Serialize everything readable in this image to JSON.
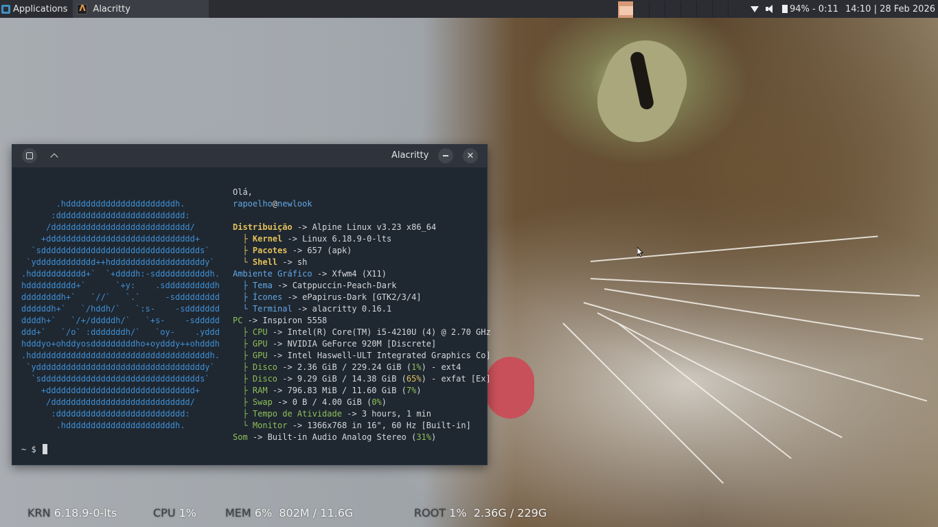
{
  "panel": {
    "applications_label": "Applications",
    "task_title": "Alacritty",
    "battery": "94% - 0:11",
    "clock": "14:10 | 28 Feb 2026"
  },
  "window": {
    "title": "Alacritty"
  },
  "terminal": {
    "logo_lines": [
      "       .hddddddddddddddddddddddh.",
      "      :dddddddddddddddddddddddddd:",
      "     /dddddddddddddddddddddddddddd/",
      "    +dddddddddddddddddddddddddddddd+",
      "  `sdddddddddddddddddddddddddddddddds`",
      " `ydddddddddddd++hdddddddddddddddddddy`",
      ".hddddddddddd+`  `+ddddh:-sdddddddddddh.",
      "hdddddddddd+`      `+y:    .sddddddddddh",
      "ddddddddh+`   `//`   `.`     -sddddddddd",
      "ddddddh+`   `/hddh/`   `:s-    -sddddddd",
      "ddddh+`   `/+/dddddh/`   `+s-    -sddddd",
      "ddd+`   `/o` :dddddddh/`   `oy-    .yddd",
      "hdddyo+ohddyosdddddddddho+oydddy++ohdddh",
      ".hddddddddddddddddddddddddddddddddddddh.",
      " `yddddddddddddddddddddddddddddddddddy`",
      "  `sdddddddddddddddddddddddddddddddds`",
      "    +dddddddddddddddddddddddddddddd+",
      "     /dddddddddddddddddddddddddddd/",
      "      :dddddddddddddddddddddddddd:",
      "       .hddddddddddddddddddddddh."
    ],
    "greeting": "Olá,",
    "user": "rapoelho",
    "at": "@",
    "host": "newlook",
    "distro_label": "Distribuição",
    "distro_value": " -> Alpine Linux v3.23 x86_64",
    "kernel_label": "Kernel",
    "kernel_value": " -> Linux 6.18.9-0-lts",
    "packages_label": "Pacotes",
    "packages_value": " -> 657 (apk)",
    "shell_label": "Shell",
    "shell_value": " -> sh",
    "de_label": "Ambiente Gráfico",
    "de_value": " -> Xfwm4 (X11)",
    "theme_label": "Tema",
    "theme_value": " -> Catppuccin-Peach-Dark",
    "icons_label": "Ícones",
    "icons_value": " -> ePapirus-Dark [GTK2/3/4]",
    "terminal_label": "Terminal",
    "terminal_value": " -> alacritty 0.16.1",
    "pc_label": "PC",
    "pc_value": " -> Inspiron 5558",
    "cpu_label": "CPU",
    "cpu_value": " -> Intel(R) Core(TM) i5-4210U (4) @ 2.70 GHz",
    "gpu1_label": "GPU",
    "gpu1_value": " -> NVIDIA GeForce 920M [Discrete]",
    "gpu2_label": "GPU",
    "gpu2_value": " -> Intel Haswell-ULT Integrated Graphics Co]",
    "disk1_label": "Disco",
    "disk1_pre": " -> 2.36 GiB / 229.24 GiB (",
    "disk1_pct": "1%",
    "disk1_post": ") - ext4",
    "disk2_label": "Disco",
    "disk2_pre": " -> 9.29 GiB / 14.38 GiB (",
    "disk2_pct": "65%",
    "disk2_post": ") - exfat [Ex]",
    "ram_label": "RAM",
    "ram_pre": " -> 796.83 MiB / 11.60 GiB (",
    "ram_pct": "7%",
    "ram_post": ")",
    "swap_label": "Swap",
    "swap_pre": " -> 0 B / 4.00 GiB (",
    "swap_pct": "0%",
    "swap_post": ")",
    "uptime_label": "Tempo de Atividade",
    "uptime_value": " -> 3 hours, 1 min",
    "monitor_label": "Monitor",
    "monitor_value": " -> 1366x768 in 16\", 60 Hz [Built-in]",
    "sound_label": "Som",
    "sound_pre": " -> Built-in Audio Analog Stereo (",
    "sound_pct": "31%",
    "sound_post": ")",
    "prompt": "~ $ "
  },
  "conky": {
    "krn_label": "KRN",
    "krn_value": " 6.18.9-0-lts",
    "cpu_label": "CPU",
    "cpu_value": " 1%",
    "mem_label": "MEM",
    "mem_value": " 6%  802M / 11.6G",
    "root_label": "ROOT",
    "root_value": " 1%  2.36G / 229G"
  },
  "colors": {
    "panel_bg": "#2b2d33",
    "terminal_bg": "#1f2730",
    "logo": "#3f8fd5",
    "key": "#e2c15b",
    "accent_workspace": "#d79a78"
  }
}
